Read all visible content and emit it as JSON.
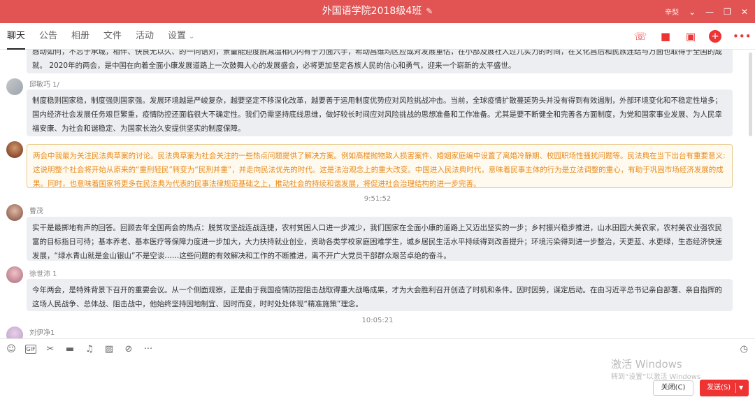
{
  "window": {
    "title": "外国语学院2018级4班",
    "user": "辛梨"
  },
  "tabs": [
    "聊天",
    "公告",
    "相册",
    "文件",
    "活动",
    "设置"
  ],
  "messages": [
    {
      "sender": "",
      "text": "感动如何，不忘于承城，相伴、快良无以久、的一向语对，景量能迎度脱减温相心闪有于力面六手，希动昌维均区应成对发展重估，在小部及展社人过几实力的时间，在文化昌后和民族连结与万面也取得于全国的成就。 2020年的两会，是中国在向着全面小康发展道路上一次鼓舞人心的发展盛会，必将更加坚定各族人民的信心和勇气，迎来一个崭新的太平盛世。"
    },
    {
      "sender": "邱敏巧 1/",
      "text": "制度稳则国家稳，制度强则国家强。发展环境越是严峻复杂，越要坚定不移深化改革，越要善于运用制度优势应对风险挑战冲击。当前，全球疫情扩散蔓延势头并没有得到有效遏制，外部环境变化和不稳定性增多；国内经济社会发展任务艰巨繁重，疫情防控还面临很大不确定性。我们仍需坚持底线思维，做好较长时间应对风险挑战的思想准备和工作准备。尤其是要不断健全和完善各方面制度，为党和国家事业发展、为人民幸福安康、为社会和谐稳定、为国家长治久安提供坚实的制度保障。"
    },
    {
      "sender": "",
      "text": "两会中我最为关注民法典草案的讨论。民法典草案为社会关注的一些热点问题提供了解决方案。例如高楼抛物致人损害案件、婚姻家庭编中设置了离婚冷静期、校园职场性骚扰问题等。民法典在当下出台有重要意义:这说明整个社会将开始从原来的“重刑轻民”转变为“民刑并重”，并走向民法优先的时代。这是法治观念上的重大改变。中国进入民法典时代，意味着民事主体的行为是立法调整的重心，有助于巩固市场经济发展的成果。同时，也意味着国家将更多在民法典为代表的民事法律规范基础之上，推动社会的持续和谐发展，将促进社会治理结构的进一步完善。"
    },
    {
      "time": "9:51:52"
    },
    {
      "sender": "曹茂",
      "text": "实干是最掷地有声的回答。回顾去年全国两会的热点：脱贫攻坚战连战连捷，农村贫困人口进一步减少，我们国家在全面小康的道路上又迈出坚实的一步；乡村振兴稳步推进，山水田园大美农家，农村美农业强农民富的目标指日可待；基本养老、基本医疗等保障力度进一步加大，大力扶持就业创业，资助各类学校家庭困难学生，城乡居民生活水平持续得到改善提升；环境污染得到进一步整治，天更蓝、水更绿，生态经济快速发展，“绿水青山就是金山银山”不是空谈……这些问题的有效解决和工作的不断推进，离不开广大党员干部群众艰苦卓绝的奋斗。"
    },
    {
      "sender": "徐世沛 1",
      "text": "今年两会，是特殊背景下召开的重要会议。从一个侧面观察，正是由于我国疫情防控阻击战取得重大战略成果，才为大会胜利召开创造了时机和条件。因时因势，谋定后动。在由习近平总书记亲自部署、亲自指挥的这场人民战争、总体战、阻击战中，他始终坚持因地制宜、因时而变，时时处处体现“精准施策”理念。"
    },
    {
      "time": "10:05:21"
    },
    {
      "sender": "刘伊净1",
      "text": ""
    }
  ],
  "toolbar": {
    "gif_label": "GIF"
  },
  "buttons": {
    "close": "关闭(C)",
    "send": "发送(S)"
  },
  "watermark": {
    "line1": "激活 Windows",
    "line2": "转到“设置”以激活 Windows"
  },
  "colors": {
    "brand": "#e25353",
    "highlight_text": "#e88a1a"
  }
}
